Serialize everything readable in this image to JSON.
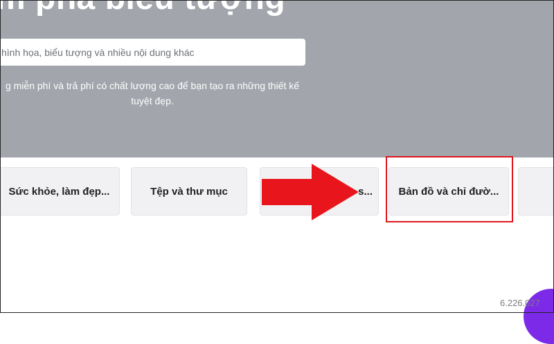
{
  "hero": {
    "title": "m phá biểu tượng",
    "search_placeholder": "hình họa, biểu tượng và nhiều nội dung khác",
    "description": "g miễn phí và trả phí có chất lượng cao để bạn tạo ra những thiết kế tuyệt đẹp."
  },
  "categories": [
    {
      "label": "Sức khỏe, làm đẹp..."
    },
    {
      "label": "Tệp và thư mục"
    },
    {
      "label": "s..."
    },
    {
      "label": "Bản đồ và chỉ đườ..."
    },
    {
      "label": ""
    }
  ],
  "annotations": {
    "arrow_color": "#e8161c",
    "highlight_color": "#e0141b"
  },
  "footer": {
    "version": "6.226.027"
  },
  "colors": {
    "hero_bg": "#a2a6ac",
    "card_bg": "#f1f1f3",
    "brand_bubble": "#7d2ae8"
  }
}
